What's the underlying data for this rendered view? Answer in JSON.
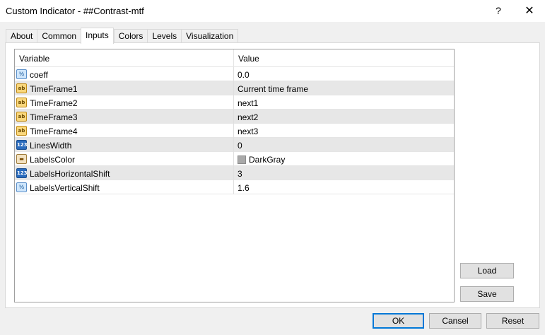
{
  "window": {
    "title": "Custom Indicator - ##Contrast-mtf",
    "help_glyph": "?",
    "close_glyph": "✕"
  },
  "tabs": [
    {
      "label": "About"
    },
    {
      "label": "Common"
    },
    {
      "label": "Inputs"
    },
    {
      "label": "Colors"
    },
    {
      "label": "Levels"
    },
    {
      "label": "Visualization"
    }
  ],
  "active_tab": "Inputs",
  "grid": {
    "headers": {
      "variable": "Variable",
      "value": "Value"
    },
    "rows": [
      {
        "icon": "double-icon",
        "icon_text": "½",
        "name": "coeff",
        "value": "0.0"
      },
      {
        "icon": "string-icon",
        "icon_text": "ab",
        "name": "TimeFrame1",
        "value": "Current time frame"
      },
      {
        "icon": "string-icon",
        "icon_text": "ab",
        "name": "TimeFrame2",
        "value": "next1"
      },
      {
        "icon": "string-icon",
        "icon_text": "ab",
        "name": "TimeFrame3",
        "value": "next2"
      },
      {
        "icon": "string-icon",
        "icon_text": "ab",
        "name": "TimeFrame4",
        "value": "next3"
      },
      {
        "icon": "int-icon",
        "icon_text": "123",
        "name": "LinesWidth",
        "value": "0"
      },
      {
        "icon": "color-icon",
        "icon_text": "▬",
        "name": "LabelsColor",
        "value": "DarkGray",
        "swatch_color": "#a9a9a9"
      },
      {
        "icon": "int-icon",
        "icon_text": "123",
        "name": "LabelsHorizontalShift",
        "value": "3"
      },
      {
        "icon": "double-icon",
        "icon_text": "½",
        "name": "LabelsVerticalShift",
        "value": "1.6"
      }
    ]
  },
  "side_buttons": {
    "load": "Load",
    "save": "Save"
  },
  "footer_buttons": {
    "ok": "OK",
    "cancel": "Cansel",
    "reset": "Reset"
  }
}
